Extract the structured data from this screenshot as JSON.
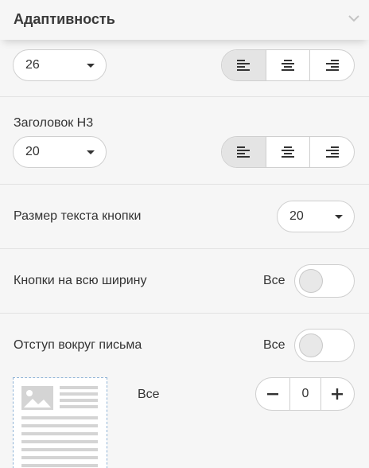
{
  "panel": {
    "title": "Адаптивность",
    "collapse_icon": "chevron-down-icon"
  },
  "heading_h2": {
    "size_value": "26",
    "alignment_options": [
      "align-left-icon",
      "align-center-icon",
      "align-right-icon"
    ],
    "active_alignment": "left"
  },
  "heading_h3": {
    "label": "Заголовок H3",
    "size_value": "20",
    "alignment_options": [
      "align-left-icon",
      "align-center-icon",
      "align-right-icon"
    ],
    "active_alignment": "left"
  },
  "button_text_size": {
    "label": "Размер текста кнопки",
    "value": "20"
  },
  "full_width_buttons": {
    "label": "Кнопки на всю ширину",
    "scope_label": "Все",
    "enabled": false
  },
  "email_padding": {
    "label": "Отступ вокруг письма",
    "scope_label": "Все",
    "enabled": false,
    "preview_scope_label": "Все",
    "stepper_value": "0",
    "stepper_minus": "−",
    "stepper_plus": "+"
  },
  "colors": {
    "background": "#f6f6f6",
    "border": "#cfcfcf",
    "active_segment": "#e4e4e4",
    "preview_border": "#8fb3d6"
  }
}
